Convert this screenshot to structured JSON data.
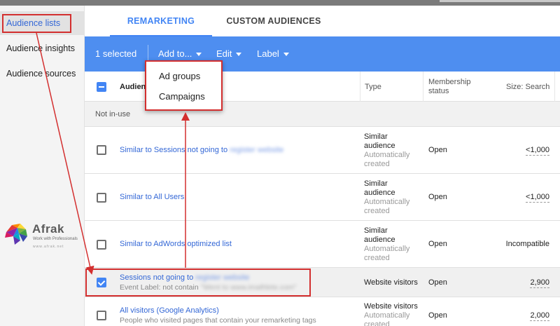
{
  "sidebar": {
    "items": [
      {
        "label": "Audience lists",
        "active": true
      },
      {
        "label": "Audience insights",
        "active": false
      },
      {
        "label": "Audience sources",
        "active": false
      }
    ],
    "logo": {
      "name": "Afrak",
      "tagline": "Work with Professionals",
      "url": "www.afrak.net"
    }
  },
  "tabs": [
    {
      "label": "REMARKETING",
      "active": true
    },
    {
      "label": "CUSTOM AUDIENCES",
      "active": false
    }
  ],
  "actionbar": {
    "selected_label": "1 selected",
    "add_to_label": "Add to...",
    "edit_label": "Edit",
    "label_label": "Label"
  },
  "dropdown": {
    "items": [
      "Ad groups",
      "Campaigns"
    ]
  },
  "table": {
    "headers": {
      "name": "Audien",
      "type": "Type",
      "membership": "Membership status",
      "size": "Size: Search"
    },
    "group_label": "Not in-use",
    "rows": [
      {
        "name": "Similar to Sessions not going to",
        "name_blur": "register website",
        "type_line1": "Similar",
        "type_line2": "audience",
        "type_sub1": "Automatically",
        "type_sub2": "created",
        "status": "Open",
        "size": "<1,000",
        "checked": false
      },
      {
        "name": "Similar to All Users",
        "type_line1": "Similar",
        "type_line2": "audience",
        "type_sub1": "Automatically",
        "type_sub2": "created",
        "status": "Open",
        "size": "<1,000",
        "checked": false
      },
      {
        "name": "Similar to AdWords optimized list",
        "type_line1": "Similar",
        "type_line2": "audience",
        "type_sub1": "Automatically",
        "type_sub2": "created",
        "status": "Open",
        "size": "Incompatible",
        "checked": false
      },
      {
        "name": "Sessions not going to",
        "name_blur": "register website",
        "sub": "Event Label: not contain",
        "sub_blur": "\"Went to www.imathlete.com\"",
        "type_line1": "Website visitors",
        "status": "Open",
        "size": "2,900",
        "checked": true
      },
      {
        "name": "All visitors (Google Analytics)",
        "sub": "People who visited pages that contain your remarketing tags",
        "type_line1": "Website visitors",
        "type_sub1": "Automatically",
        "type_sub2": "created",
        "status": "Open",
        "size": "2,000",
        "checked": false
      }
    ]
  },
  "colors": {
    "accent": "#4285f4",
    "actionbar": "#4e8ef0",
    "annotation": "#d32f2f"
  }
}
